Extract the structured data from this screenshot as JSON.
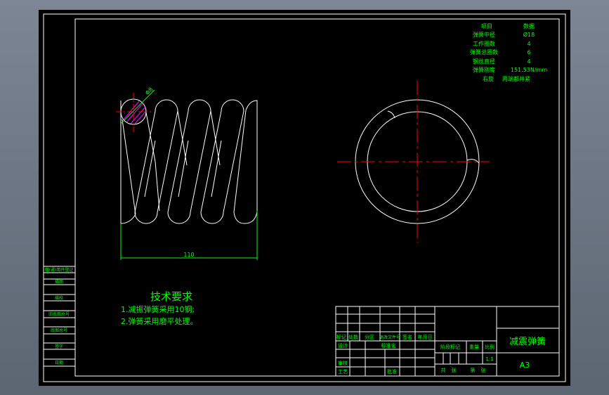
{
  "spec_table": {
    "header": [
      "项目",
      "数据"
    ],
    "rows": [
      [
        "弹簧中径",
        "Ø18"
      ],
      [
        "工作圈数",
        "4"
      ],
      [
        "弹簧总圈数",
        "6"
      ],
      [
        "钢丝直径",
        "4"
      ],
      [
        "弹簧刚度",
        "151.53N/mm"
      ],
      [
        "右旋",
        "两端都并紧"
      ]
    ]
  },
  "dimensions": {
    "length": "110",
    "wire_diameter": "Φ8"
  },
  "tech_requirements": {
    "title": "技术要求",
    "items": [
      "1.减振弹簧采用10钢;",
      "2.弹簧采用磨平处理。"
    ]
  },
  "left_strip": [
    "借(通)用件登记",
    "描图",
    "描校",
    "旧底图总号",
    "底图总号",
    "签字",
    "日期"
  ],
  "title_block": {
    "rev_headers": [
      "标记",
      "处数",
      "分区",
      "更改文件号",
      "签名",
      "年月日"
    ],
    "design": "设计",
    "standard": "标准化",
    "review": "审核",
    "process": "工艺",
    "approve": "批准",
    "stage_mark": "阶段标记",
    "weight": "重量",
    "scale_label": "比例",
    "scale": "1:1",
    "sheets": [
      "共",
      "张",
      "第",
      "张"
    ],
    "drawing_name": "减震弹簧",
    "size": "A3"
  },
  "colors": {
    "text": "#00ff00",
    "lines": "#ffffff",
    "centerline": "#ff0000",
    "hatch": "#ff00ff"
  }
}
